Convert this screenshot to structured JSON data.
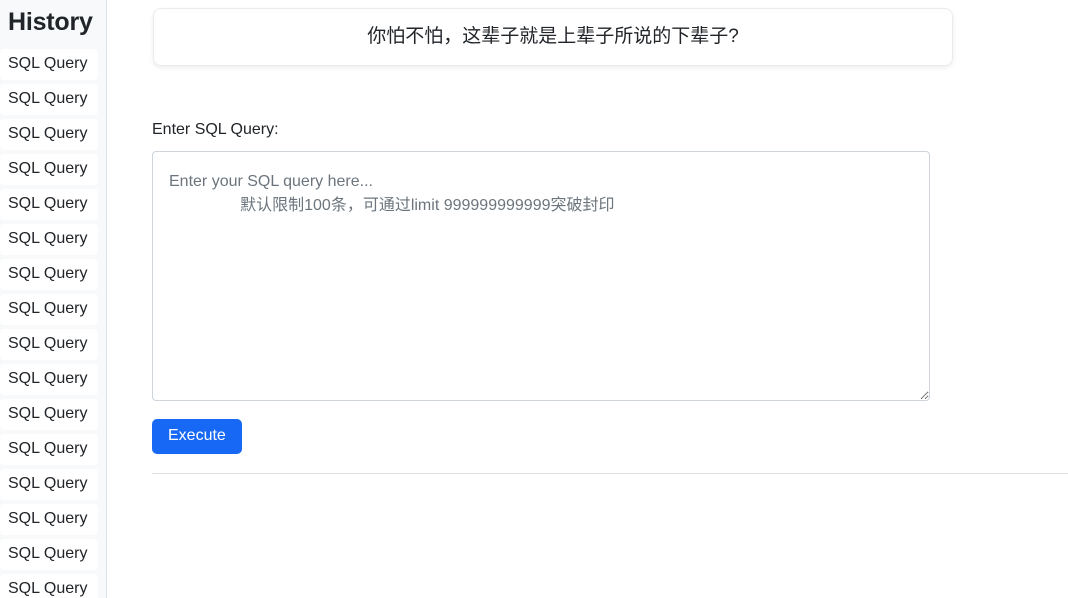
{
  "sidebar": {
    "title": "History",
    "items": [
      {
        "label": "SQL Query"
      },
      {
        "label": "SQL Query"
      },
      {
        "label": "SQL Query"
      },
      {
        "label": "SQL Query"
      },
      {
        "label": "SQL Query"
      },
      {
        "label": "SQL Query"
      },
      {
        "label": "SQL Query"
      },
      {
        "label": "SQL Query"
      },
      {
        "label": "SQL Query"
      },
      {
        "label": "SQL Query"
      },
      {
        "label": "SQL Query"
      },
      {
        "label": "SQL Query"
      },
      {
        "label": "SQL Query"
      },
      {
        "label": "SQL Query"
      },
      {
        "label": "SQL Query"
      },
      {
        "label": "SQL Query"
      }
    ]
  },
  "main": {
    "banner": {
      "text": "你怕不怕，这辈子就是上辈子所说的下辈子?"
    },
    "query_form": {
      "label": "Enter SQL Query:",
      "textarea_value": "",
      "textarea_placeholder": "Enter your SQL query here...\n                默认限制100条，可通过limit 999999999999突破封印",
      "execute_label": "Execute"
    },
    "results": {
      "text": ""
    }
  },
  "colors": {
    "accent": "#1769f5",
    "sidebar_background": "#f8f9fa",
    "border": "#dee2e6",
    "text": "#212529",
    "placeholder_text": "#6c757d"
  }
}
